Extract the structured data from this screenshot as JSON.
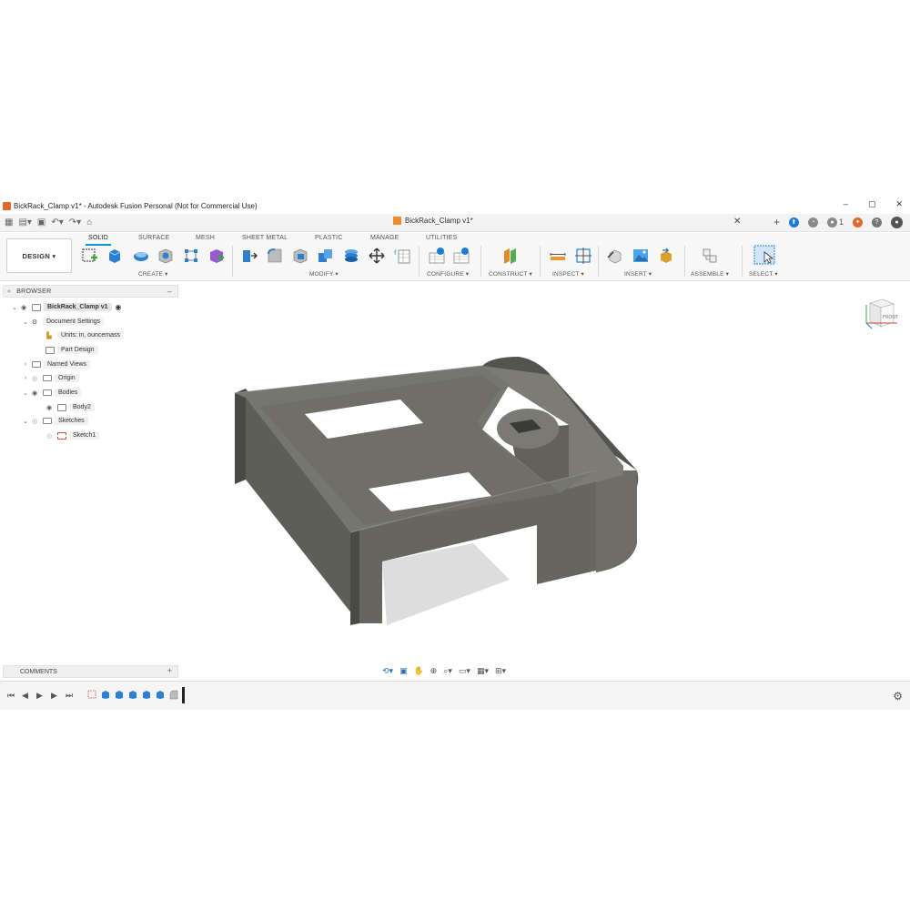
{
  "window": {
    "title": "BickRack_Clamp v1* - Autodesk Fusion Personal (Not for Commercial Use)",
    "controls": [
      "–",
      "▢",
      "✕"
    ]
  },
  "document_tab": {
    "name": "BickRack_Clamp v1*",
    "close": "✕",
    "add": "+"
  },
  "account": {
    "notifications": "1"
  },
  "ribbon": {
    "workspace": "DESIGN ▾",
    "tabs": [
      "SOLID",
      "SURFACE",
      "MESH",
      "SHEET METAL",
      "PLASTIC",
      "MANAGE",
      "UTILITIES"
    ],
    "active_tab": "SOLID",
    "groups": [
      "CREATE ▾",
      "MODIFY ▾",
      "CONFIGURE ▾",
      "CONSTRUCT ▾",
      "INSPECT ▾",
      "INSERT ▾",
      "ASSEMBLE ▾",
      "SELECT ▾"
    ]
  },
  "browser": {
    "title": "BROWSER",
    "collapse": "–",
    "items": [
      {
        "label": "BickRack_Clamp v1"
      },
      {
        "label": "Document Settings"
      },
      {
        "label": "Units: in, ouncemass"
      },
      {
        "label": "Part Design"
      },
      {
        "label": "Named Views"
      },
      {
        "label": "Origin"
      },
      {
        "label": "Bodies"
      },
      {
        "label": "Body2"
      },
      {
        "label": "Sketches"
      },
      {
        "label": "Sketch1"
      }
    ]
  },
  "viewcube": {
    "face": "FRONT"
  },
  "comments": {
    "title": "COMMENTS",
    "add": "+"
  },
  "colors": {
    "accent": "#0696d7",
    "model_top": "#707068",
    "model_side": "#5a5a54",
    "model_dark": "#45453f",
    "app_logo": "#e0682b"
  }
}
